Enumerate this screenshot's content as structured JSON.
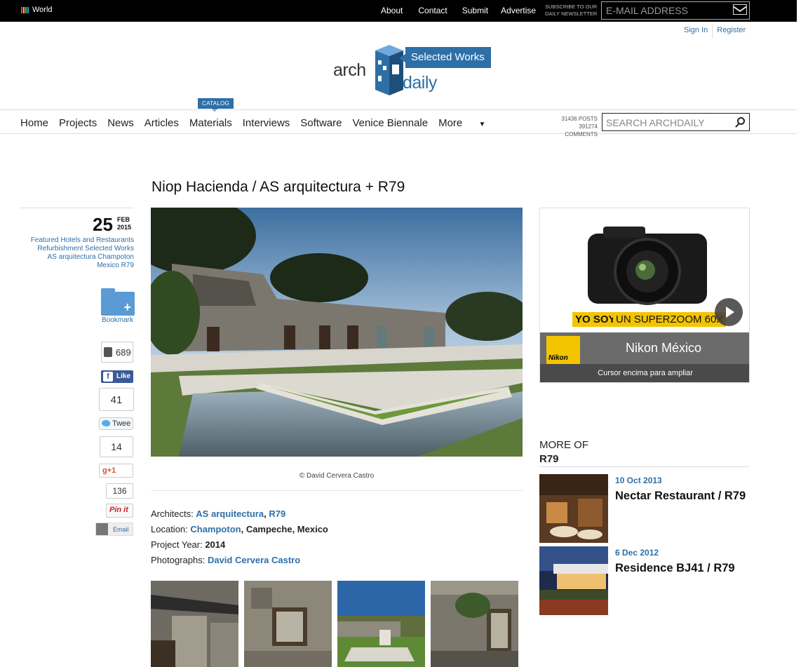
{
  "topbar": {
    "world": "World",
    "links": [
      "About",
      "Contact",
      "Submit",
      "Advertise"
    ],
    "subscribe": "SUBSCRIBE TO OUR DAILY NEWSLETTER",
    "email_placeholder": "E-MAIL ADDRESS"
  },
  "auth": {
    "signin": "Sign In",
    "register": "Register"
  },
  "logo": {
    "arch": "arch",
    "daily": "daily",
    "badge": "Selected Works"
  },
  "nav": {
    "items": [
      "Home",
      "Projects",
      "News",
      "Articles",
      "Materials",
      "Interviews",
      "Software",
      "Venice Biennale",
      "More"
    ],
    "more_arrow": "▼",
    "catalog_badge": "CATALOG",
    "stats_posts": "31436 POSTS",
    "stats_comments": "391274 COMMENTS",
    "search_placeholder": "SEARCH ARCHDAILY"
  },
  "article": {
    "title": "Niop Hacienda / AS arquitectura + R79",
    "date_day": "25",
    "date_month": "FEB",
    "date_year": "2015",
    "tags_lines": [
      "Featured  Hotels and Restaurants",
      "Refurbishment  Selected Works",
      "AS arquitectura  Champoton",
      "Mexico  R79"
    ],
    "caption": "© David Cervera Castro",
    "architects_label": "Architects: ",
    "architect_1": "AS arquitectura",
    "architect_sep": ", ",
    "architect_2": "R79",
    "location_label": "Location: ",
    "location_link": "Champoton",
    "location_rest": ", Campeche, Mexico",
    "year_label": "Project Year: ",
    "year_value": "2014",
    "photos_label": "Photographs: ",
    "photos_value": "David Cervera Castro"
  },
  "share": {
    "bookmark": "Bookmark",
    "fb_count": "689",
    "fb_like": "Like",
    "tw_count": "41",
    "tw_label": "Twee",
    "gp_count": "14",
    "gp_label": "g+1",
    "pin_count": "136",
    "pin_label": "Pin it",
    "email_label": "Email"
  },
  "ad": {
    "adchoice": "▷",
    "yosoy": "YO SOY",
    "superzoom": "UN SUPERZOOM 60X",
    "brand": "Nikon México",
    "logo_text": "Nikon",
    "hint": "Cursor encima para ampliar"
  },
  "more_of": {
    "label": "MORE OF",
    "name": "R79",
    "items": [
      {
        "date": "10 Oct 2013",
        "title": "Nectar Restaurant / R79"
      },
      {
        "date": "6 Dec 2012",
        "title": "Residence BJ41 / R79"
      }
    ]
  },
  "colors": {
    "accent": "#2e6fa7",
    "topbar": "#000000",
    "ad_yellow": "#f3c400"
  }
}
